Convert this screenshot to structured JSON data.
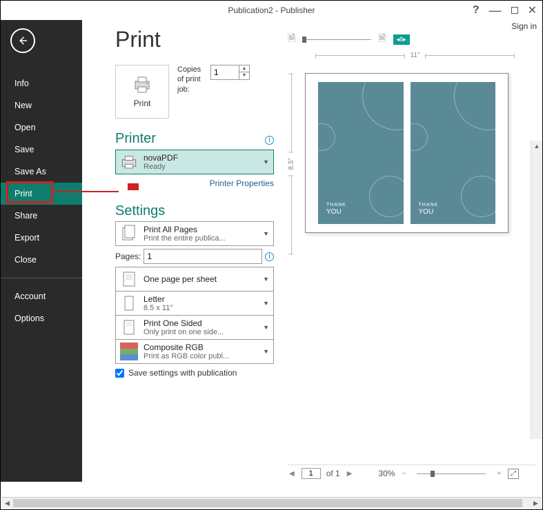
{
  "title": "Publication2 - Publisher",
  "signin": "Sign in",
  "sidebar": {
    "items": [
      "Info",
      "New",
      "Open",
      "Save",
      "Save As",
      "Print",
      "Share",
      "Export",
      "Close"
    ],
    "items2": [
      "Account",
      "Options"
    ],
    "active": "Print"
  },
  "page_title": "Print",
  "print_button": "Print",
  "copies_label": "Copies of print job:",
  "copies_value": "1",
  "printer_section": "Printer",
  "printer": {
    "name": "novaPDF",
    "status": "Ready",
    "properties_link": "Printer Properties"
  },
  "settings_section": "Settings",
  "settings": {
    "print_all": {
      "main": "Print All Pages",
      "sub": "Print the entire publica..."
    },
    "pages_label": "Pages:",
    "pages_value": "1",
    "layout": {
      "main": "One page per sheet",
      "sub": ""
    },
    "paper": {
      "main": "Letter",
      "sub": "8.5 x 11\""
    },
    "sided": {
      "main": "Print One Sided",
      "sub": "Only print on one side..."
    },
    "color": {
      "main": "Composite RGB",
      "sub": "Print as RGB color publ..."
    },
    "save_checkbox": "Save settings with publication"
  },
  "preview": {
    "zoom_badge": "8",
    "ruler_w": "11\"",
    "ruler_h": "8.5\"",
    "card_thank": "THANK",
    "card_you": "YOU",
    "page_current": "1",
    "page_total": "of 1",
    "zoom_pct": "30%"
  }
}
